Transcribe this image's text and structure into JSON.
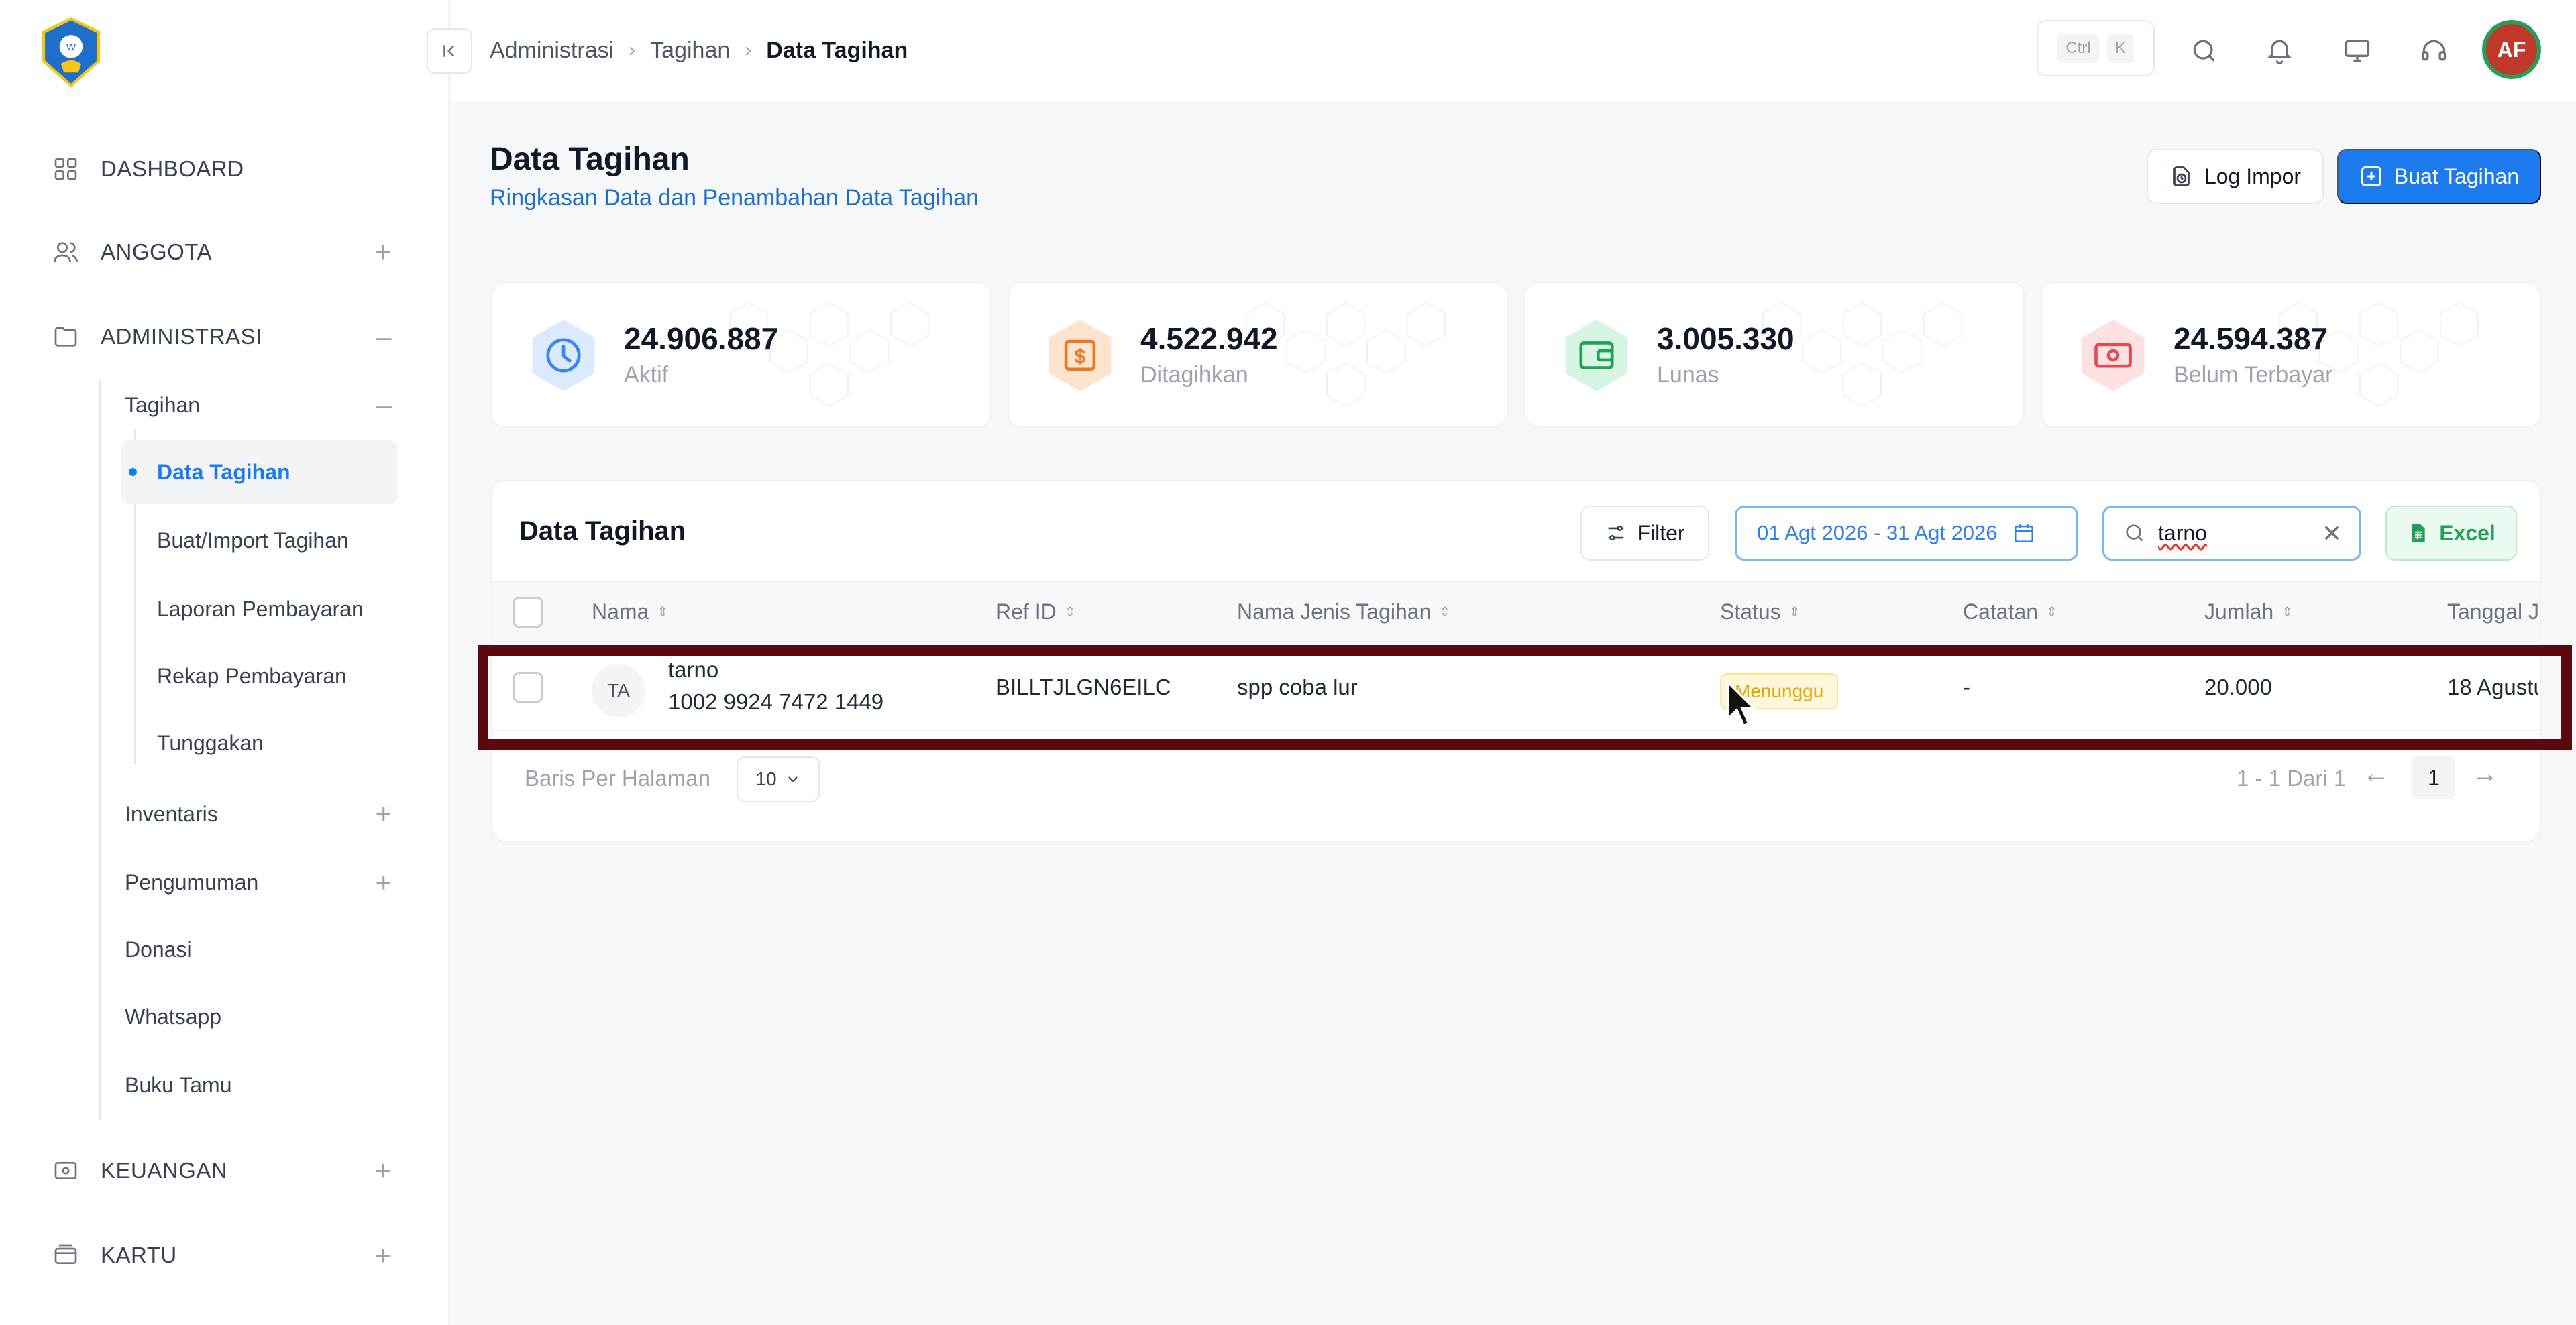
{
  "sidebar": {
    "logo_icon": "tut-wuri-handayani-logo",
    "items": [
      {
        "label": "DASHBOARD",
        "icon": "grid-icon"
      },
      {
        "label": "ANGGOTA",
        "icon": "users-icon",
        "toggle": "+"
      },
      {
        "label": "ADMINISTRASI",
        "icon": "folder-icon",
        "toggle": "–"
      },
      {
        "label": "KEUANGAN",
        "icon": "wallet-icon",
        "toggle": "+"
      },
      {
        "label": "KARTU",
        "icon": "card-icon",
        "toggle": "+"
      }
    ],
    "admin_children": [
      {
        "label": "Tagihan",
        "toggle": "–"
      },
      {
        "label": "Inventaris",
        "toggle": "+"
      },
      {
        "label": "Pengumuman",
        "toggle": "+"
      },
      {
        "label": "Donasi"
      },
      {
        "label": "Whatsapp"
      },
      {
        "label": "Buku Tamu"
      }
    ],
    "tagihan_children": [
      {
        "label": "Data Tagihan",
        "active": true
      },
      {
        "label": "Buat/Import Tagihan"
      },
      {
        "label": "Laporan Pembayaran"
      },
      {
        "label": "Rekap Pembayaran"
      },
      {
        "label": "Tunggakan"
      }
    ]
  },
  "header": {
    "collapse_icon": "collapse-left-icon",
    "breadcrumb": [
      "Administrasi",
      "Tagihan",
      "Data Tagihan"
    ],
    "kbd": [
      "Ctrl",
      "K"
    ],
    "icons": [
      "search-icon",
      "bell-icon",
      "monitor-icon",
      "headset-icon"
    ],
    "avatar_initials": "AF"
  },
  "page": {
    "title": "Data Tagihan",
    "subtitle": "Ringkasan Data dan Penambahan Data Tagihan",
    "log_button": "Log Impor",
    "create_button": "Buat Tagihan"
  },
  "stats": [
    {
      "value": "24.906.887",
      "label": "Aktif",
      "color": "#3b82f6",
      "bg": "#dbeafe",
      "icon": "clock-icon"
    },
    {
      "value": "4.522.942",
      "label": "Ditagihkan",
      "color": "#ea7a1e",
      "bg": "#fde4cf",
      "icon": "dollar-icon"
    },
    {
      "value": "3.005.330",
      "label": "Lunas",
      "color": "#22a05a",
      "bg": "#d6f5e2",
      "icon": "wallet-icon"
    },
    {
      "value": "24.594.387",
      "label": "Belum Terbayar",
      "color": "#e5484d",
      "bg": "#fde0e1",
      "icon": "cash-icon"
    }
  ],
  "table": {
    "title": "Data Tagihan",
    "filter_label": "Filter",
    "date_range": "01 Agt 2026 - 31 Agt 2026",
    "search_value": "tarno",
    "excel_label": "Excel",
    "columns": [
      "Nama",
      "Ref ID",
      "Nama Jenis Tagihan",
      "Status",
      "Catatan",
      "Jumlah",
      "Tanggal J"
    ],
    "rows": [
      {
        "initials": "TA",
        "name": "tarno",
        "id": "1002 9924 7472 1449",
        "ref_id": "BILLTJLGN6EILC",
        "jenis": "spp coba lur",
        "status": "Menunggu",
        "catatan": "-",
        "jumlah": "20.000",
        "tanggal": "18 Agustu"
      }
    ],
    "rows_per_page_label": "Baris Per Halaman",
    "rows_per_page": "10",
    "pagination_info": "1 - 1 Dari 1",
    "current_page": "1"
  }
}
